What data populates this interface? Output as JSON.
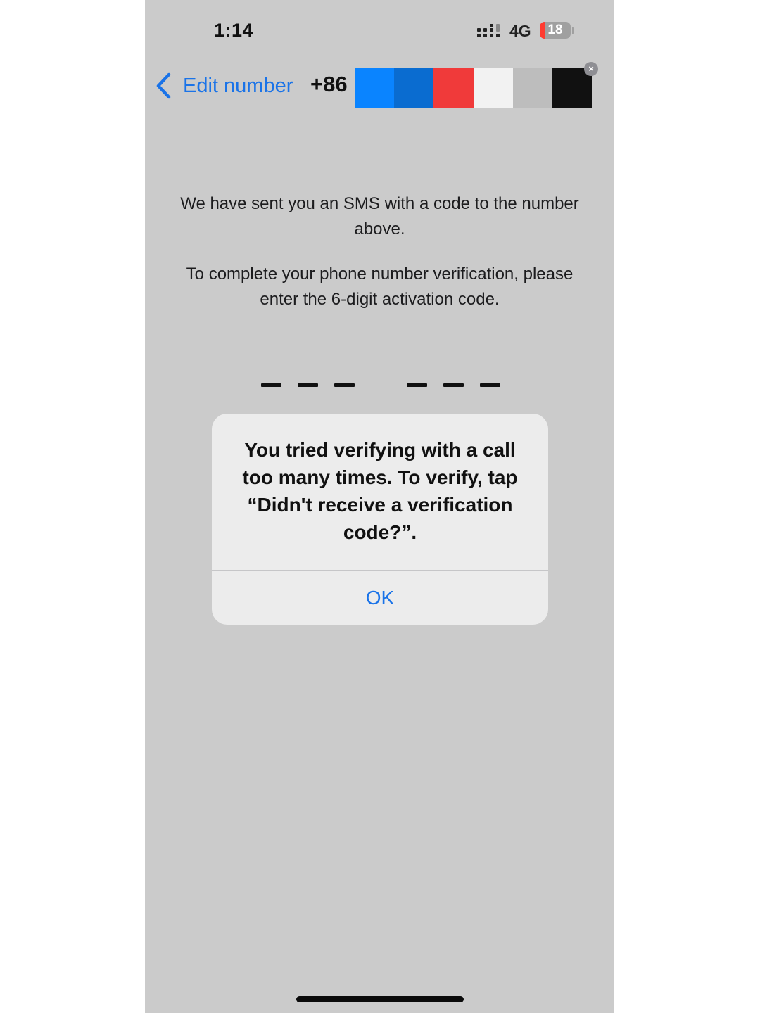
{
  "status_bar": {
    "time": "1:14",
    "network": "4G",
    "battery_level": "18",
    "battery_fraction": 0.18,
    "signal_icon": "cellular-signal-icon",
    "battery_icon": "battery-low-icon"
  },
  "header": {
    "back_label": "Edit number",
    "back_icon": "chevron-left-icon",
    "country_code": "+86",
    "redaction_colors": [
      "#0a84ff",
      "#0a6cd0",
      "#f03a3a",
      "#f2f2f2",
      "#bdbdbd",
      "#111111"
    ],
    "clear_icon": "close-circle-icon",
    "clear_glyph": "×"
  },
  "main": {
    "sms_notice": "We have sent you an SMS with a code to the number above.",
    "instruction": "To complete your phone number verification, please enter the 6-digit activation code.",
    "code_length": 6
  },
  "alert": {
    "message": "You tried verifying with a call too many times. To verify, tap “Didn't receive a verification code?”.",
    "ok_label": "OK"
  },
  "colors": {
    "accent": "#1a73e8",
    "background": "#cbcbcb",
    "alert_background": "#ececec",
    "battery_low": "#ff3b30"
  }
}
